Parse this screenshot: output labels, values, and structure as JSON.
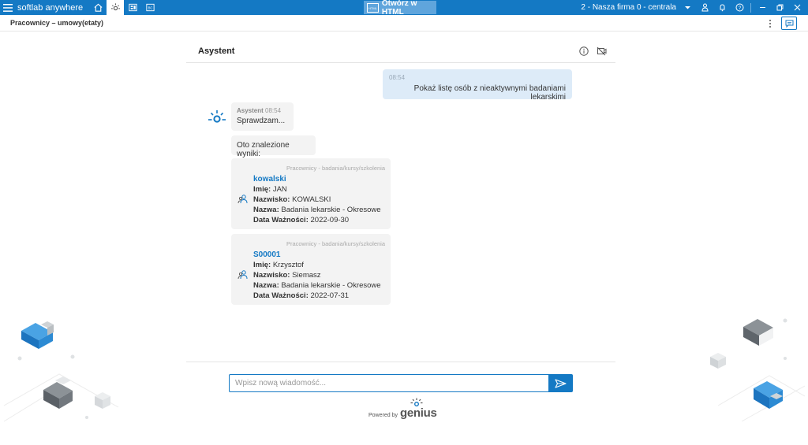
{
  "topbar": {
    "brand": "softlab anywhere",
    "center_button": "Otwórz w HTML",
    "center_icon_text": "HTML",
    "company": "2 - Nasza firma 0 - centrala"
  },
  "subbar": {
    "title": "Pracownicy – umowy(etaty)"
  },
  "chat": {
    "title": "Asystent",
    "user_message": {
      "time": "08:54",
      "text": "Pokaż listę osób z nieaktywnymi badaniami lekarskimi"
    },
    "bot_message": {
      "sender": "Asystent",
      "time": "08:54",
      "text": "Sprawdzam..."
    },
    "results_intro": "Oto znalezione wyniki:",
    "results": [
      {
        "source": "Pracownicy - badania/kursy/szkolenia",
        "link": "kowalski",
        "imie_label": "Imię:",
        "imie": "JAN",
        "nazwisko_label": "Nazwisko:",
        "nazwisko": "KOWALSKI",
        "nazwa_label": "Nazwa:",
        "nazwa": "Badania lekarskie - Okresowe",
        "data_label": "Data Ważności:",
        "data": "2022-09-30"
      },
      {
        "source": "Pracownicy - badania/kursy/szkolenia",
        "link": "S00001",
        "imie_label": "Imię:",
        "imie": "Krzysztof",
        "nazwisko_label": "Nazwisko:",
        "nazwisko": "Siemasz",
        "nazwa_label": "Nazwa:",
        "nazwa": "Badania lekarskie - Okresowe",
        "data_label": "Data Ważności:",
        "data": "2022-07-31"
      }
    ],
    "input_placeholder": "Wpisz nową wiadomość...",
    "powered_by": "Powered by",
    "powered_logo": "genius"
  },
  "colors": {
    "accent": "#1479c4",
    "user_bubble": "#ddebf8",
    "bot_bubble": "#f3f3f3"
  }
}
